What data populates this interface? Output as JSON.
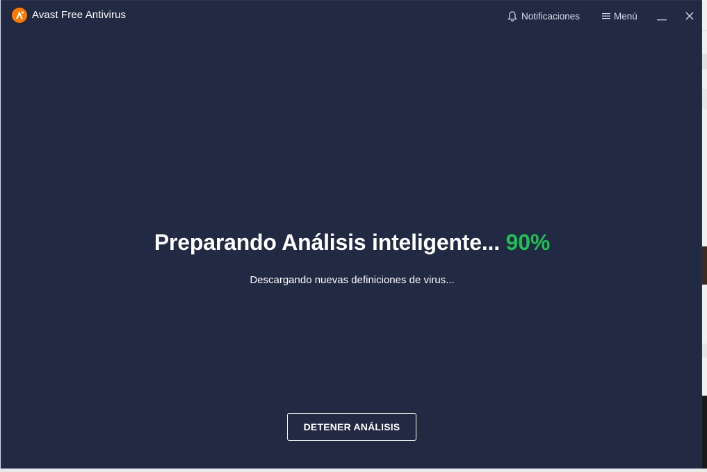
{
  "window": {
    "app_title": "Avast Free Antivirus",
    "notifications_label": "Notificaciones",
    "menu_label": "Menú"
  },
  "scan": {
    "headline": "Preparando Análisis inteligente...",
    "progress_percent": "90%",
    "status_text": "Descargando nuevas definiciones de virus...",
    "stop_button_label": "DETENER ANÁLISIS"
  },
  "icons": {
    "logo": "avast-logo-icon",
    "notifications": "bell-icon",
    "menu": "hamburger-menu-icon",
    "minimize": "minimize-icon",
    "close": "close-icon"
  },
  "colors": {
    "background": "#212a42",
    "accent_orange": "#ff7800",
    "progress_green": "#1fbf55",
    "text": "#ffffff"
  }
}
